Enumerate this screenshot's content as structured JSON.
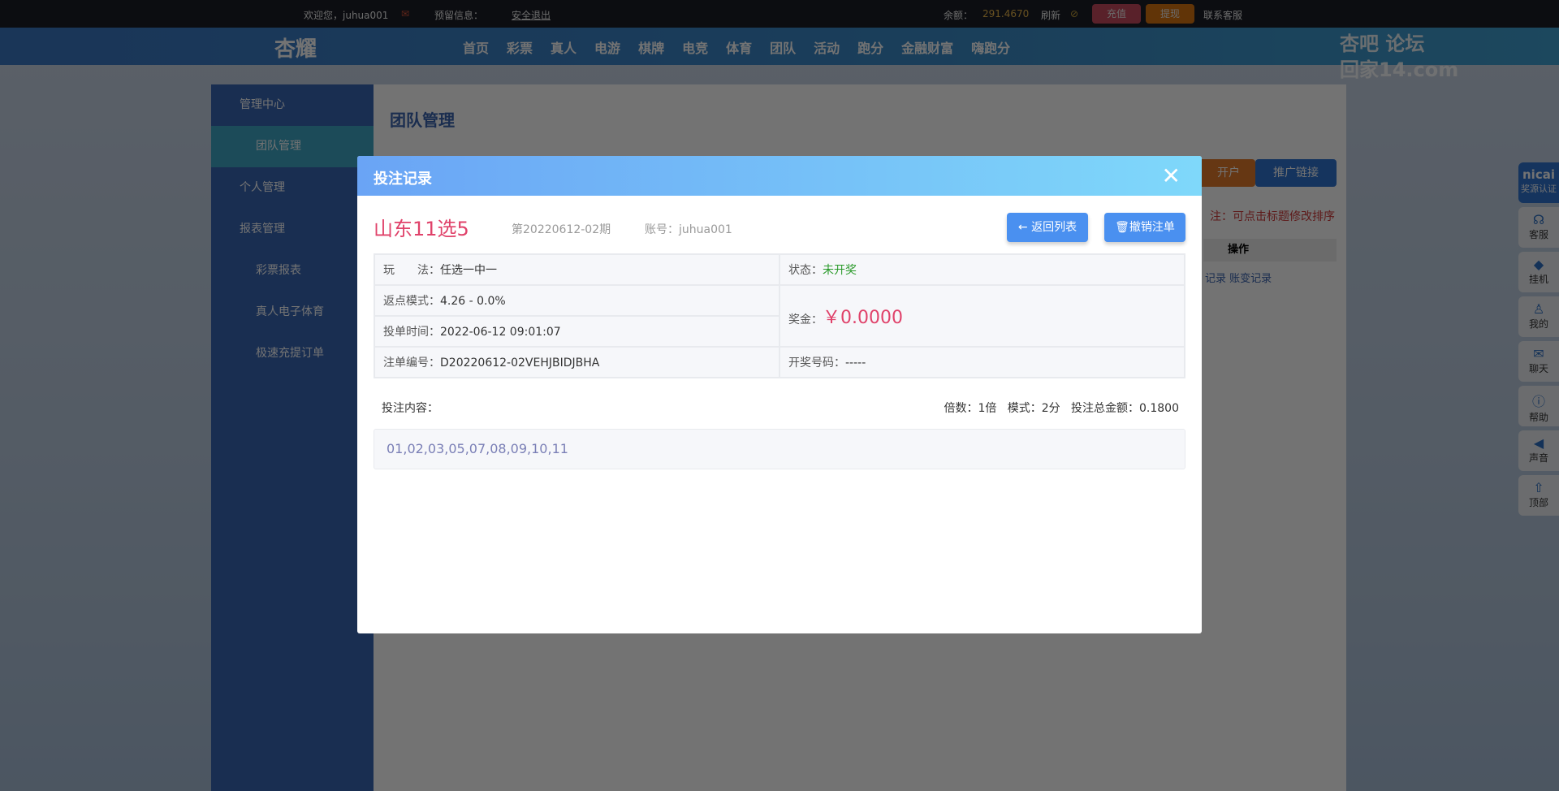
{
  "topbar": {
    "welcome": "欢迎您，juhua001",
    "reserved": "预留信息：",
    "logout": "安全退出",
    "balance_label": "余额：",
    "balance": "291.4670",
    "refresh": "刷新",
    "recharge": "充值",
    "withdraw": "提现",
    "support": "联系客服"
  },
  "nav": {
    "logo": "杏耀",
    "items": [
      "首页",
      "彩票",
      "真人",
      "电游",
      "棋牌",
      "电竞",
      "体育",
      "团队",
      "活动",
      "跑分",
      "金融财富",
      "嗨跑分"
    ],
    "watermark_top": "杏吧 论坛",
    "watermark_bottom": "回家14.com"
  },
  "sidebar": {
    "items": [
      "管理中心",
      "团队管理",
      "个人管理",
      "报表管理",
      "彩票报表",
      "真人电子体育",
      "极速充提订单"
    ]
  },
  "main": {
    "title": "团队管理",
    "open_account": "开户",
    "promo_link": "推广链接",
    "note": "注：可点击标题修改排序",
    "col_action": "操作",
    "links": [
      "记录",
      "账变记录"
    ]
  },
  "right_sidebar": {
    "badge": "nicai",
    "badge_sub": "奖源认证",
    "items": [
      "客服",
      "挂机",
      "我的",
      "聊天",
      "帮助",
      "声音",
      "顶部"
    ]
  },
  "modal": {
    "title": "投注记录",
    "lottery": "山东11选5",
    "issue": "第20220612-02期",
    "account": "账号：juhua001",
    "back": "返回列表",
    "cancel": "撤销注单",
    "play_label": "玩　　法：",
    "play": "任选一中一",
    "status_label": "状态：",
    "status": "未开奖",
    "rebate_label": "返点模式：",
    "rebate": "4.26 - 0.0%",
    "prize_label": "奖金：",
    "prize": "￥0.0000",
    "time_label": "投单时间：",
    "time": "2022-06-12 09:01:07",
    "order_label": "注单编号：",
    "order": "D20220612-02VEHJBIDJBHA",
    "draw_label": "开奖号码：",
    "draw": "-----",
    "content_label": "投注内容：",
    "summary": "倍数：1倍   模式：2分   投注总金额：0.1800",
    "numbers": "01,02,03,05,07,08,09,10,11"
  },
  "colors": {
    "accent": "#4a90f0",
    "red": "#e0426a",
    "green": "#2a9a2a"
  }
}
